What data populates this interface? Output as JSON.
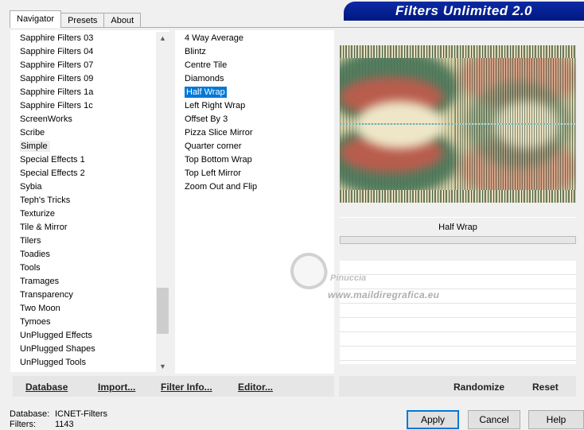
{
  "tabs": [
    "Navigator",
    "Presets",
    "About"
  ],
  "banner": "Filters Unlimited 2.0",
  "categories": [
    "Sapphire Filters 03",
    "Sapphire Filters 04",
    "Sapphire Filters 07",
    "Sapphire Filters 09",
    "Sapphire Filters 1a",
    "Sapphire Filters 1c",
    "ScreenWorks",
    "Scribe",
    "Simple",
    "Special Effects 1",
    "Special Effects 2",
    "Sybia",
    "Teph's Tricks",
    "Texturize",
    "Tile & Mirror",
    "Tilers",
    "Toadies",
    "Tools",
    "Tramages",
    "Transparency",
    "Two Moon",
    "Tymoes",
    "UnPlugged Effects",
    "UnPlugged Shapes",
    "UnPlugged Tools"
  ],
  "selected_category": "Simple",
  "filters": [
    "4 Way Average",
    "Blintz",
    "Centre Tile",
    "Diamonds",
    "Half Wrap",
    "Left Right Wrap",
    "Offset By 3",
    "Pizza Slice Mirror",
    "Quarter corner",
    "Top Bottom Wrap",
    "Top Left Mirror",
    "Zoom Out and Flip"
  ],
  "selected_filter": "Half Wrap",
  "filter_name_display": "Half Wrap",
  "progress_fraction": 0,
  "watermark": {
    "line1": "Pinuccia",
    "line2": "www.maildiregrafica.eu"
  },
  "left_buttons": {
    "database": "Database",
    "import": "Import...",
    "filter_info": "Filter Info...",
    "editor": "Editor..."
  },
  "right_buttons": {
    "randomize": "Randomize",
    "reset": "Reset"
  },
  "status": {
    "database_label": "Database:",
    "database_value": "ICNET-Filters",
    "filters_label": "Filters:",
    "filters_value": "1143"
  },
  "dialog_buttons": {
    "apply": "Apply",
    "cancel": "Cancel",
    "help": "Help"
  },
  "icons": {
    "scroll_up": "chevron-up-icon",
    "scroll_down": "chevron-down-icon"
  }
}
